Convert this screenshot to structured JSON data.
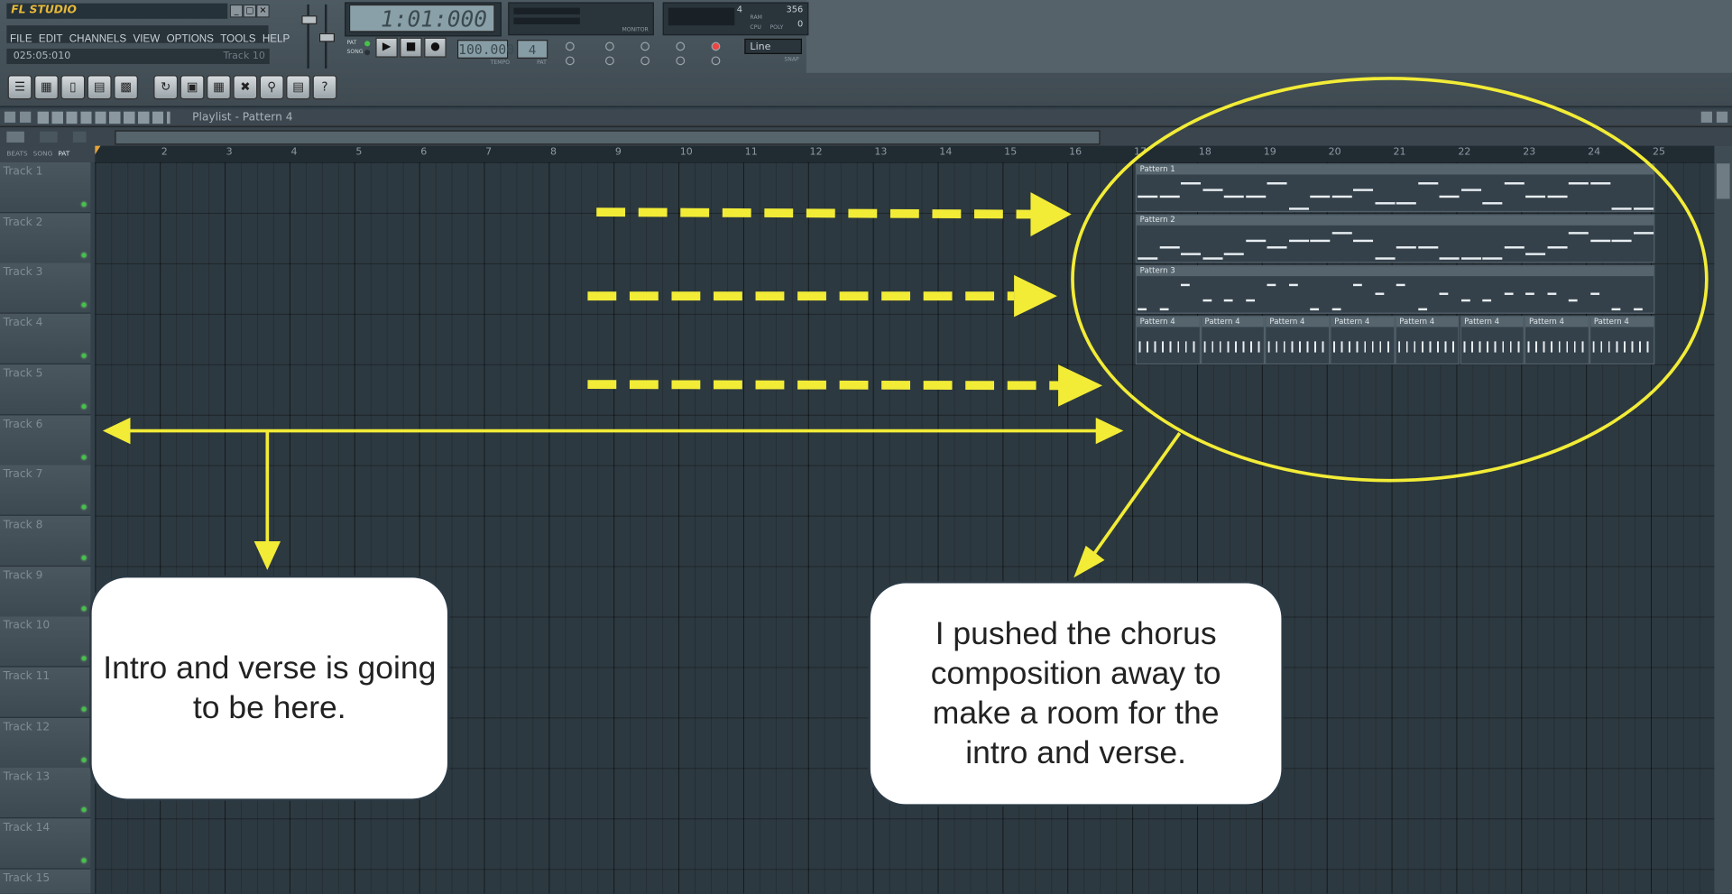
{
  "app": {
    "logo": "FL STUDIO",
    "window_buttons": [
      "_",
      "▢",
      "✕"
    ],
    "menu": [
      "FILE",
      "EDIT",
      "CHANNELS",
      "VIEW",
      "OPTIONS",
      "TOOLS",
      "HELP"
    ],
    "hint_position": "025:05:010",
    "hint_track": "Track 10"
  },
  "transport": {
    "song_time": "1:01:000",
    "tempo": "100.000",
    "tempo_label": "TEMPO",
    "pattern_number": "4",
    "pattern_label": "PAT",
    "pat_song": [
      "PAT",
      "SONG"
    ],
    "snap": "Line",
    "snap_label": "SNAP",
    "monitor_label": "MONITOR",
    "cpu_label": "CPU",
    "poly_label": "POLY",
    "ram_label": "RAM",
    "cpu_value": "4",
    "mem_value": "356",
    "poly_value": "0"
  },
  "playlist": {
    "title": "Playlist - Pattern 4",
    "ruler_left_labels": [
      "BEATS",
      "SONG",
      "PAT"
    ],
    "bars": [
      "2",
      "3",
      "4",
      "5",
      "6",
      "7",
      "8",
      "9",
      "10",
      "11",
      "12",
      "13",
      "14",
      "15",
      "16",
      "17",
      "18",
      "19",
      "20",
      "21",
      "22",
      "23",
      "24",
      "25"
    ],
    "tracks": [
      "Track 1",
      "Track 2",
      "Track 3",
      "Track 4",
      "Track 5",
      "Track 6",
      "Track 7",
      "Track 8",
      "Track 9",
      "Track 10",
      "Track 11",
      "Track 12",
      "Track 13",
      "Track 14",
      "Track 15"
    ],
    "clips": {
      "pattern1": "Pattern 1",
      "pattern2": "Pattern 2",
      "pattern3": "Pattern 3",
      "pattern4": [
        "Pattern 4",
        "Pattern 4",
        "Pattern 4",
        "Pattern 4",
        "Pattern 4",
        "Pattern 4",
        "Pattern 4",
        "Pattern 4"
      ]
    }
  },
  "annotations": {
    "left_bubble": "Intro and verse is going to be here.",
    "right_bubble": "I pushed the chorus composition away to make a room for the intro and verse.",
    "color": "#f2ec37"
  }
}
